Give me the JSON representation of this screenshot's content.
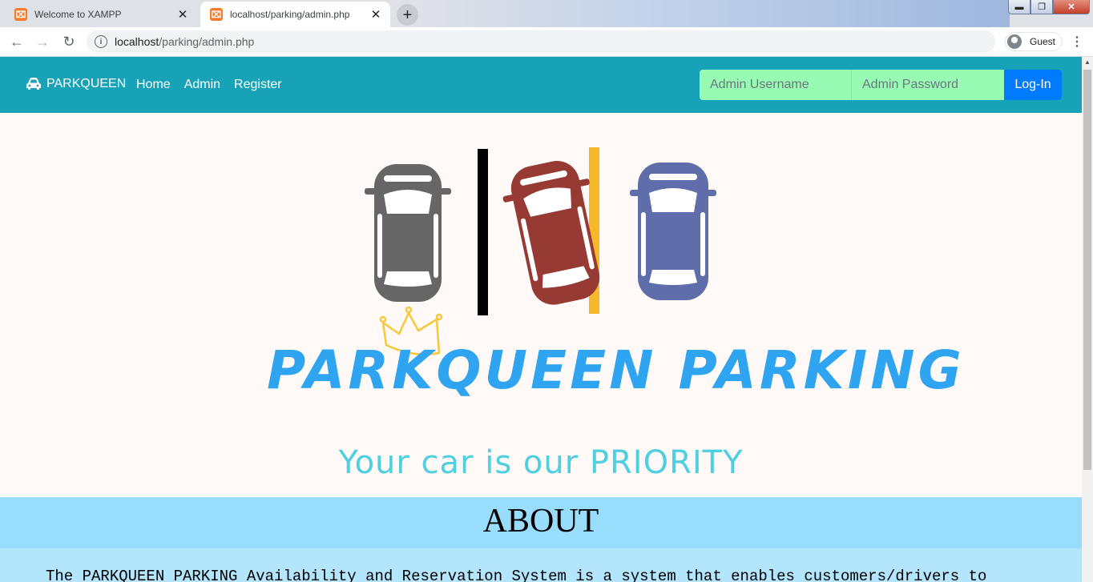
{
  "browser": {
    "tabs": [
      {
        "title": "Welcome to XAMPP",
        "active": false
      },
      {
        "title": "localhost/parking/admin.php",
        "active": true
      }
    ],
    "url_host": "localhost",
    "url_path": "/parking/admin.php",
    "profile_label": "Guest",
    "icons": {
      "back": "back-arrow-icon",
      "forward": "forward-arrow-icon",
      "reload": "reload-icon",
      "info": "info-icon",
      "menu": "kebab-menu-icon",
      "favicon": "xampp-icon"
    }
  },
  "navbar": {
    "brand": "PARKQUEEN",
    "links": [
      "Home",
      "Admin",
      "Register"
    ],
    "username_placeholder": "Admin Username",
    "password_placeholder": "Admin Password",
    "login_label": "Log-In",
    "colors": {
      "bar": "#17a2b8",
      "input": "#98fbb4",
      "button": "#007bff"
    }
  },
  "hero": {
    "logo_text": "PARKQUEEN PARKING",
    "tagline": "Your car is our PRIORITY",
    "colors": {
      "left_car": "#666666",
      "middle_car": "#963a33",
      "right_car": "#5f6eab",
      "divider_line": "#f7b92a",
      "logo_text": "#2fa4f0",
      "tagline": "#4fcfe0"
    }
  },
  "about": {
    "heading": "ABOUT",
    "text": "The PARKQUEEN PARKING Availability and Reservation System is a system that enables customers/drivers to"
  }
}
